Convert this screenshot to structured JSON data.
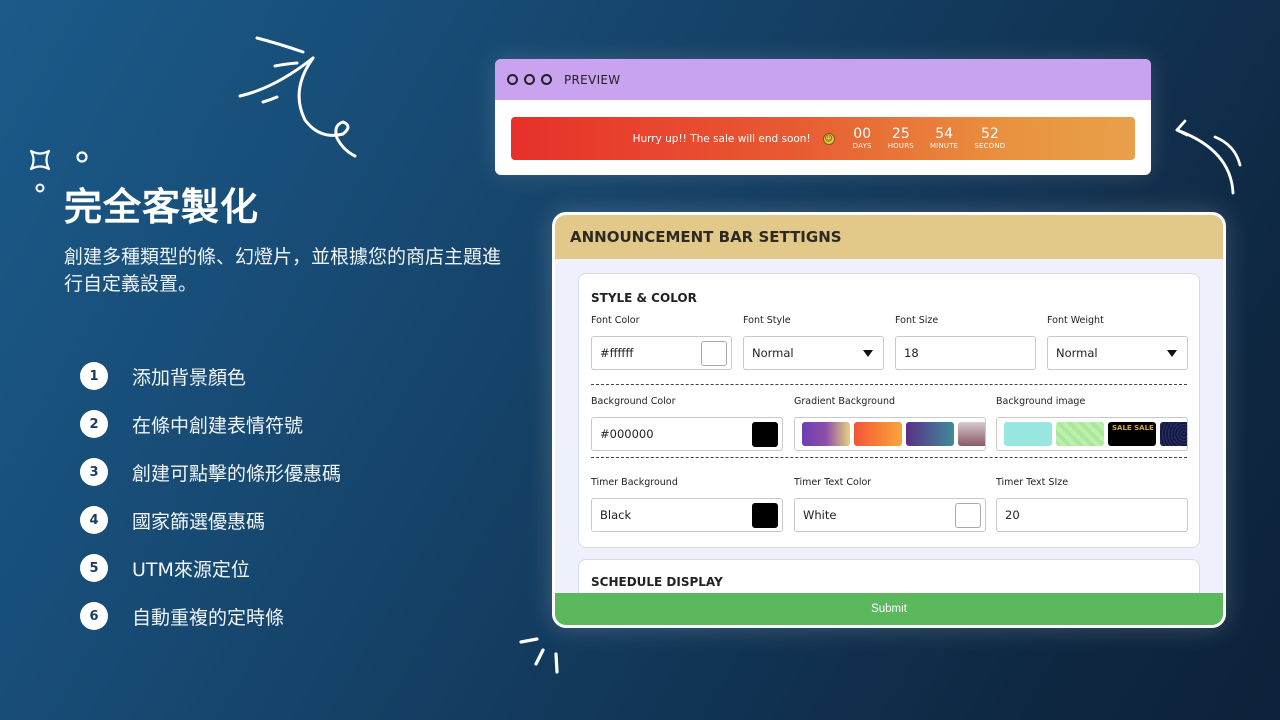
{
  "left": {
    "title": "完全客製化",
    "description": "創建多種類型的條、幻燈片，並根據您的商店主題進行自定義設置。",
    "features": [
      {
        "num": "1",
        "label": "添加背景顏色"
      },
      {
        "num": "2",
        "label": "在條中創建表情符號"
      },
      {
        "num": "3",
        "label": "創建可點擊的條形優惠碼"
      },
      {
        "num": "4",
        "label": "國家篩選優惠碼"
      },
      {
        "num": "5",
        "label": "UTM來源定位"
      },
      {
        "num": "6",
        "label": "自動重複的定時條"
      }
    ]
  },
  "preview": {
    "title": "PREVIEW",
    "bar_text": "Hurry up!! The sale will end soon!",
    "emoji": "laughing-emoji",
    "timer": [
      {
        "value": "00",
        "label": "DAYS"
      },
      {
        "value": "25",
        "label": "HOURS"
      },
      {
        "value": "54",
        "label": "MINUTE"
      },
      {
        "value": "52",
        "label": "SECOND"
      }
    ]
  },
  "settings": {
    "title": "ANNOUNCEMENT BAR SETTIGNS",
    "style_section": {
      "title": "STYLE & COLOR",
      "font_color": {
        "label": "Font Color",
        "value": "#ffffff",
        "swatch": "#ffffff"
      },
      "font_style": {
        "label": "Font Style",
        "value": "Normal"
      },
      "font_size": {
        "label": "Font Size",
        "value": "18"
      },
      "font_weight": {
        "label": "Font Weight",
        "value": "Normal"
      },
      "background_color": {
        "label": "Background Color",
        "value": "#000000",
        "swatch": "#000000"
      },
      "gradient_background": {
        "label": "Gradient Background"
      },
      "background_image": {
        "label": "Background image"
      },
      "timer_background": {
        "label": "Timer Background",
        "value": "Black",
        "swatch": "#000000"
      },
      "timer_text_color": {
        "label": "Timer Text Color",
        "value": "White",
        "swatch": "#ffffff"
      },
      "timer_text_size": {
        "label": "Timer Text SIze",
        "value": "20"
      }
    },
    "schedule_section": {
      "title": "SCHEDULE DISPLAY"
    },
    "submit_label": "Submit"
  },
  "colors": {
    "preview_header": "#c9a3ef",
    "settings_header": "#e2c98a",
    "submit": "#5cb85c"
  }
}
